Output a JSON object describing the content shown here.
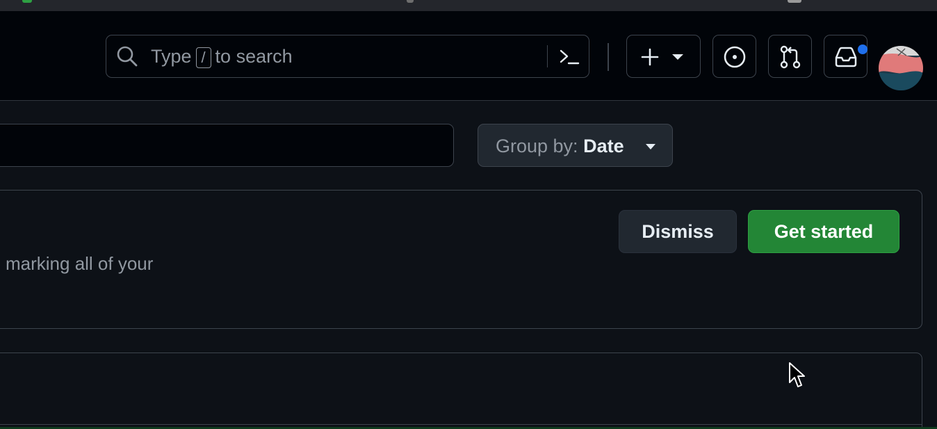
{
  "header": {
    "search": {
      "placeholder_prefix": "Type",
      "slash_key": "/",
      "placeholder_suffix": "to search",
      "search_icon": "search-icon",
      "command_palette_icon": "terminal-icon"
    },
    "create_button": {
      "icons": [
        "plus-icon",
        "triangle-down-icon"
      ]
    },
    "issues_button": {
      "icon": "issue-opened-icon"
    },
    "pull_requests_button": {
      "icon": "git-pull-request-icon"
    },
    "inbox_button": {
      "icon": "inbox-icon",
      "has_unread": true
    },
    "avatar": {
      "icon": "user-avatar"
    }
  },
  "filters": {
    "group_by_label": "Group by:",
    "group_by_value": "Date"
  },
  "banner": {
    "text": "marking all of your",
    "dismiss_label": "Dismiss",
    "get_started_label": "Get started"
  },
  "colors": {
    "background": "#0d1117",
    "header_background": "#010409",
    "border": "#3d444d",
    "primary_button": "#238636",
    "notification_dot": "#1f6feb",
    "muted_text": "#9198a1",
    "text": "#e6edf3"
  }
}
